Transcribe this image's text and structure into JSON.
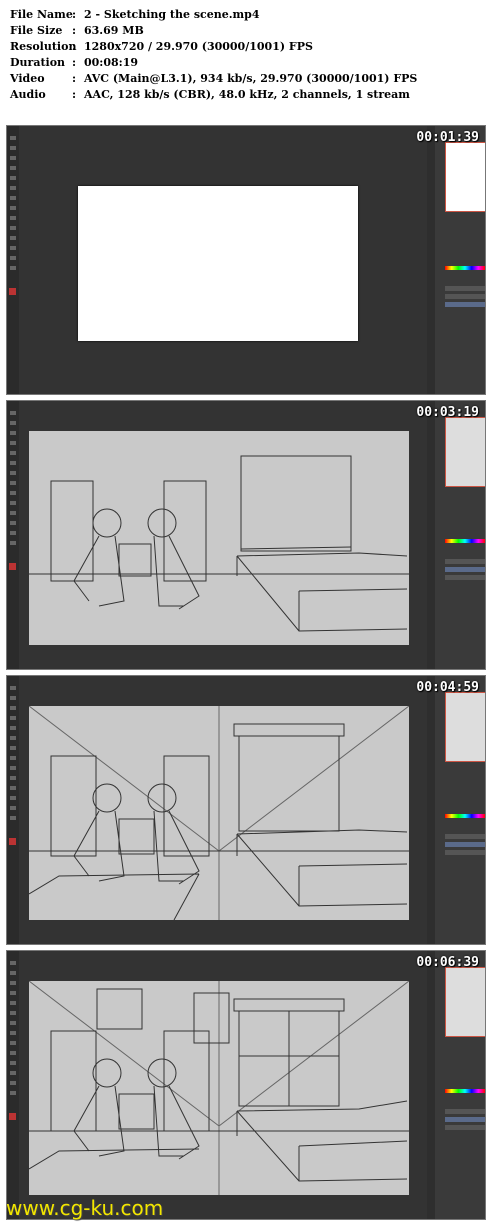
{
  "info": {
    "rows": [
      {
        "key": "File Name",
        "value": "2 - Sketching the scene.mp4"
      },
      {
        "key": "File Size",
        "value": "63.69 MB"
      },
      {
        "key": "Resolution",
        "value": "1280x720 / 29.970 (30000/1001) FPS"
      },
      {
        "key": "Duration",
        "value": "00:08:19"
      },
      {
        "key": "Video",
        "value": "AVC (Main@L3.1), 934 kb/s, 29.970 (30000/1001) FPS"
      },
      {
        "key": "Audio",
        "value": "AAC, 128 kb/s (CBR), 48.0 kHz, 2 channels, 1 stream"
      }
    ],
    "separator": ":"
  },
  "frames": [
    {
      "timestamp": "00:01:39"
    },
    {
      "timestamp": "00:03:19"
    },
    {
      "timestamp": "00:04:59"
    },
    {
      "timestamp": "00:06:39"
    }
  ],
  "watermark": "www.cg-ku.com",
  "colors": {
    "sketch_bg": "#c9c9c9",
    "app_bg": "#333333",
    "timestamp": "#ffffff",
    "watermark": "#f2e600"
  }
}
